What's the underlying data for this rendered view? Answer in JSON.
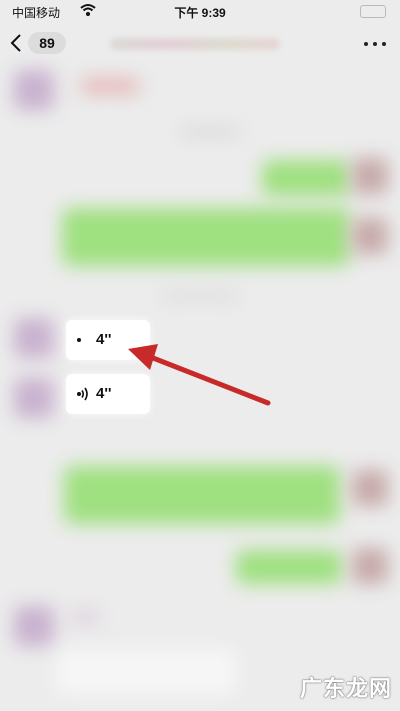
{
  "status_bar": {
    "carrier": "中国移动",
    "time": "下午 9:39"
  },
  "nav": {
    "unread_count": "89"
  },
  "voice_messages": [
    {
      "duration": "4''"
    },
    {
      "duration": "4''"
    }
  ],
  "colors": {
    "accent_arrow": "#c82a2a",
    "bubble_green": "#9fe080",
    "background": "#ececec"
  },
  "watermark": "广东龙网"
}
